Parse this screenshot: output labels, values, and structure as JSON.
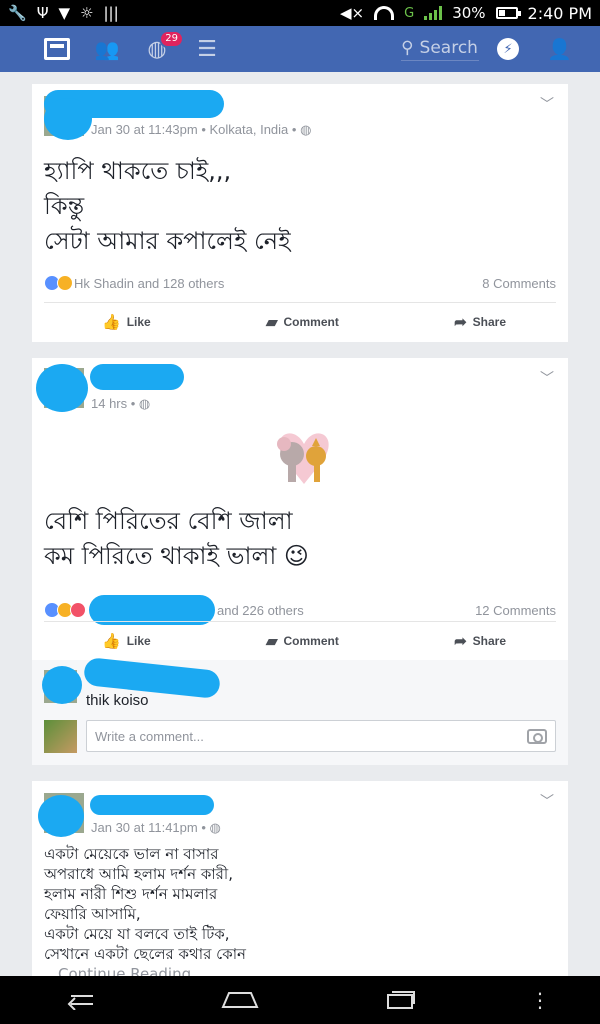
{
  "status_bar": {
    "battery": "30%",
    "network": "G",
    "time": "2:40 PM"
  },
  "topnav": {
    "notification_badge": "29",
    "search_placeholder": "Search"
  },
  "posts": [
    {
      "meta": "Jan 30 at 11:43pm • Kolkata, India • ",
      "lines": [
        "হ্যাপি থাকতে চাই,,,",
        "কিন্তু",
        "সেটা আমার কপালেই নেই"
      ],
      "reactions_text": "Hk Shadin and 128 others",
      "comments": "8 Comments"
    },
    {
      "meta": "14 hrs • ",
      "lines": [
        "বেশি পিরিতের বেশি জালা",
        "কম পিরিতে থাকাই ভালা 😉"
      ],
      "reactions_text": "and 226 others",
      "comments": "12 Comments",
      "top_comment": "thik koiso",
      "write_placeholder": "Write a comment..."
    },
    {
      "meta": "Jan 30 at 11:41pm • ",
      "lines": [
        "একটা মেয়েকে ভাল না বাসার",
        "অপরাধে আমি হলাম দর্শন কারী,",
        "হলাম নারী শিশু দর্শন মামলার",
        "ফেয়ারি আসামি,",
        "একটা মেয়ে যা বলবে তাই টিক,",
        "সেখানে একটা ছেলের কথার কোন"
      ],
      "continue": "Continue Reading"
    }
  ],
  "actions": {
    "like": "Like",
    "comment": "Comment",
    "share": "Share"
  },
  "colors": {
    "fb_blue": "#4267b2",
    "redaction_blue": "#1ba9f2"
  }
}
